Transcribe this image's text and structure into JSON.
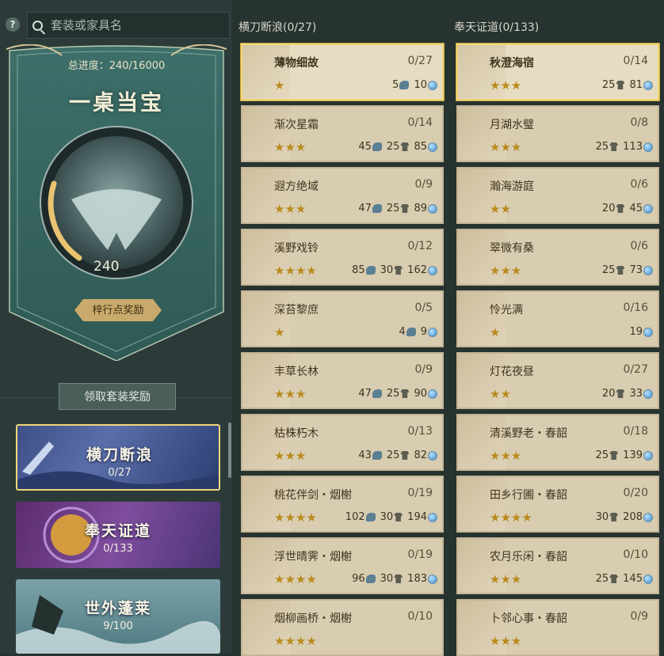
{
  "search": {
    "placeholder": "套装或家具名"
  },
  "summary": {
    "progress_label": "总进度：240/16000",
    "title": "一桌当宝",
    "orb_value": "240",
    "rank_button": "梓行点奖励",
    "claim_button": "领取套装奖励"
  },
  "sets": [
    {
      "name": "横刀断浪",
      "count": "0/27",
      "selected": true
    },
    {
      "name": "奉天证道",
      "count": "0/133",
      "selected": false
    },
    {
      "name": "世外蓬莱",
      "count": "9/100",
      "selected": false
    }
  ],
  "columns": [
    {
      "title": "横刀断浪(0/27)",
      "items": [
        {
          "name": "薄物细故",
          "progress": "0/27",
          "stars": 1,
          "blue": "5",
          "shirt": "",
          "coin": "10",
          "selected": true
        },
        {
          "name": "渐次星霜",
          "progress": "0/14",
          "stars": 3,
          "blue": "45",
          "shirt": "25",
          "coin": "85"
        },
        {
          "name": "遐方绝域",
          "progress": "0/9",
          "stars": 3,
          "blue": "47",
          "shirt": "25",
          "coin": "89"
        },
        {
          "name": "溪野戏铃",
          "progress": "0/12",
          "stars": 4,
          "blue": "85",
          "shirt": "30",
          "coin": "162"
        },
        {
          "name": "深苔黎庶",
          "progress": "0/5",
          "stars": 1,
          "blue": "4",
          "shirt": "",
          "coin": "9"
        },
        {
          "name": "丰草长林",
          "progress": "0/9",
          "stars": 3,
          "blue": "47",
          "shirt": "25",
          "coin": "90"
        },
        {
          "name": "枯株朽木",
          "progress": "0/13",
          "stars": 3,
          "blue": "43",
          "shirt": "25",
          "coin": "82"
        },
        {
          "name": "桃花伴剑・烟榭",
          "progress": "0/19",
          "stars": 4,
          "blue": "102",
          "shirt": "30",
          "coin": "194"
        },
        {
          "name": "浮世晴霁・烟榭",
          "progress": "0/19",
          "stars": 4,
          "blue": "96",
          "shirt": "30",
          "coin": "183"
        },
        {
          "name": "烟柳画桥・烟榭",
          "progress": "0/10",
          "stars": 4,
          "blue": "",
          "shirt": "",
          "coin": ""
        }
      ]
    },
    {
      "title": "奉天证道(0/133)",
      "items": [
        {
          "name": "秋澄海宿",
          "progress": "0/14",
          "stars": 3,
          "blue": "",
          "shirt": "25",
          "coin": "81",
          "selected": true
        },
        {
          "name": "月湖水璧",
          "progress": "0/8",
          "stars": 3,
          "blue": "",
          "shirt": "25",
          "coin": "113"
        },
        {
          "name": "瀚海游庭",
          "progress": "0/6",
          "stars": 2,
          "blue": "",
          "shirt": "20",
          "coin": "45"
        },
        {
          "name": "翠微有桑",
          "progress": "0/6",
          "stars": 3,
          "blue": "",
          "shirt": "25",
          "coin": "73"
        },
        {
          "name": "怜光满",
          "progress": "0/16",
          "stars": 1,
          "blue": "",
          "shirt": "",
          "coin": "19"
        },
        {
          "name": "灯花夜昼",
          "progress": "0/27",
          "stars": 2,
          "blue": "",
          "shirt": "20",
          "coin": "33"
        },
        {
          "name": "清溪野老・春韶",
          "progress": "0/18",
          "stars": 3,
          "blue": "",
          "shirt": "25",
          "coin": "139"
        },
        {
          "name": "田乡行圃・春韶",
          "progress": "0/20",
          "stars": 4,
          "blue": "",
          "shirt": "30",
          "coin": "208"
        },
        {
          "name": "农月乐闲・春韶",
          "progress": "0/10",
          "stars": 3,
          "blue": "",
          "shirt": "25",
          "coin": "145"
        },
        {
          "name": "卜邻心事・春韶",
          "progress": "0/9",
          "stars": 3,
          "blue": "",
          "shirt": "",
          "coin": ""
        }
      ]
    }
  ],
  "colors": {
    "accent": "#f0d77a",
    "panel": "#2c3b39",
    "card": "#d8ccb1",
    "star": "#b98a1c"
  }
}
